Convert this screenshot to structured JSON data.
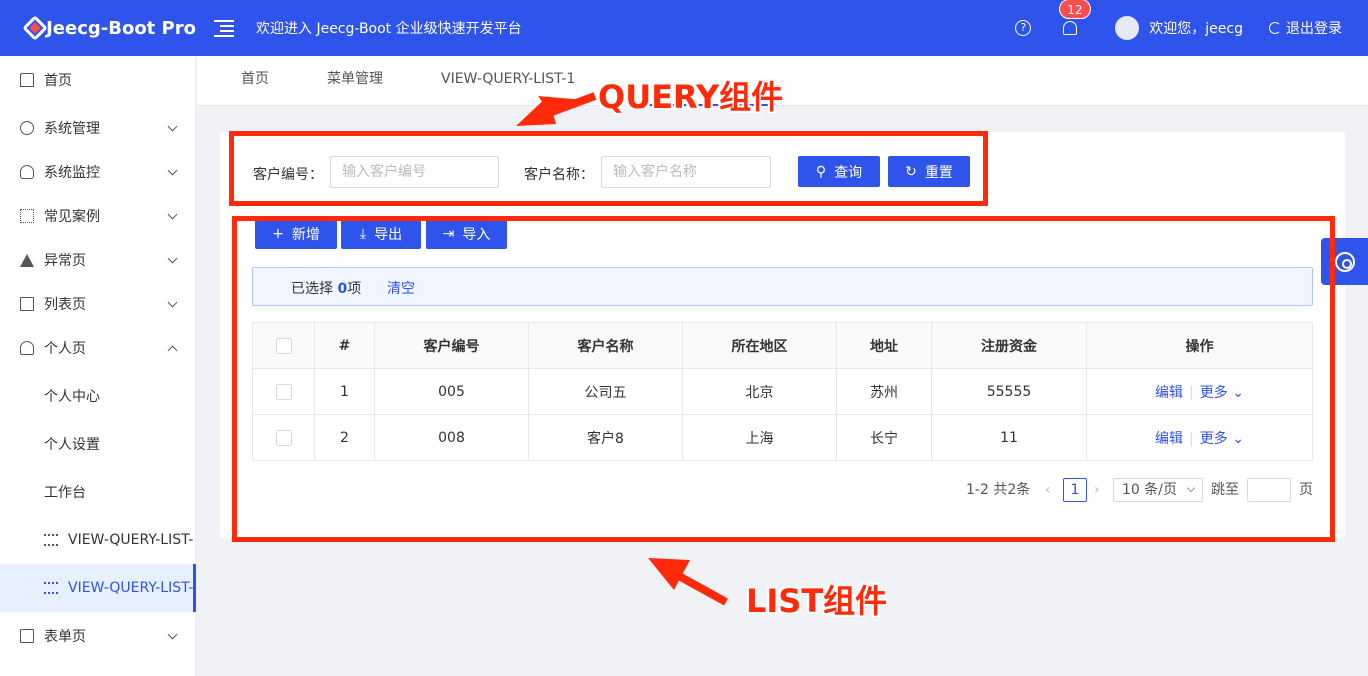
{
  "header": {
    "logo_text": "Jeecg-Boot Pro",
    "welcome_banner": "欢迎进入 Jeecg-Boot 企业级快速开发平台",
    "notification_count": "12",
    "user_greeting": "欢迎您，jeecg",
    "logout_label": "退出登录",
    "brand_color": "#2f54eb"
  },
  "sidebar": {
    "items": [
      {
        "label": "首页",
        "icon": "home-icon"
      },
      {
        "label": "系统管理",
        "icon": "gear-icon"
      },
      {
        "label": "系统监控",
        "icon": "dashboard-icon"
      },
      {
        "label": "常见案例",
        "icon": "appstore-icon"
      },
      {
        "label": "异常页",
        "icon": "warning-icon"
      },
      {
        "label": "列表页",
        "icon": "table-icon"
      },
      {
        "label": "个人页",
        "icon": "user-icon"
      },
      {
        "label": "个人中心"
      },
      {
        "label": "个人设置"
      },
      {
        "label": "工作台"
      },
      {
        "label": "VIEW-QUERY-LIST-",
        "icon": "list-icon"
      },
      {
        "label": "VIEW-QUERY-LIST-",
        "icon": "list-icon"
      },
      {
        "label": "表单页",
        "icon": "form-icon"
      }
    ]
  },
  "tabs": [
    "首页",
    "菜单管理",
    "VIEW-QUERY-LIST-1"
  ],
  "query": {
    "field1_label": "客户编号：",
    "field1_placeholder": "输入客户编号",
    "field2_label": "客户名称：",
    "field2_placeholder": "输入客户名称",
    "search_label": "查询",
    "reset_label": "重置"
  },
  "toolbar": {
    "add_label": "新增",
    "export_label": "导出",
    "import_label": "导入"
  },
  "selection": {
    "prefix": "已选择 ",
    "count": "0",
    "suffix": "项",
    "clear_label": "清空"
  },
  "table": {
    "columns": [
      "#",
      "客户编号",
      "客户名称",
      "所在地区",
      "地址",
      "注册资金",
      "操作"
    ],
    "rows": [
      {
        "index": "1",
        "code": "005",
        "name": "公司五",
        "region": "北京",
        "address": "苏州",
        "capital": "55555"
      },
      {
        "index": "2",
        "code": "008",
        "name": "客户8",
        "region": "上海",
        "address": "长宁",
        "capital": "11"
      }
    ],
    "edit_label": "编辑",
    "more_label": "更多"
  },
  "pagination": {
    "summary": "1-2 共2条",
    "current_page": "1",
    "page_size": "10 条/页",
    "jump_label": "跳至",
    "page_suffix": "页"
  },
  "annotations": {
    "query_label": "QUERY组件",
    "list_label": "LIST组件",
    "highlight_color": "#ff2a0a"
  }
}
